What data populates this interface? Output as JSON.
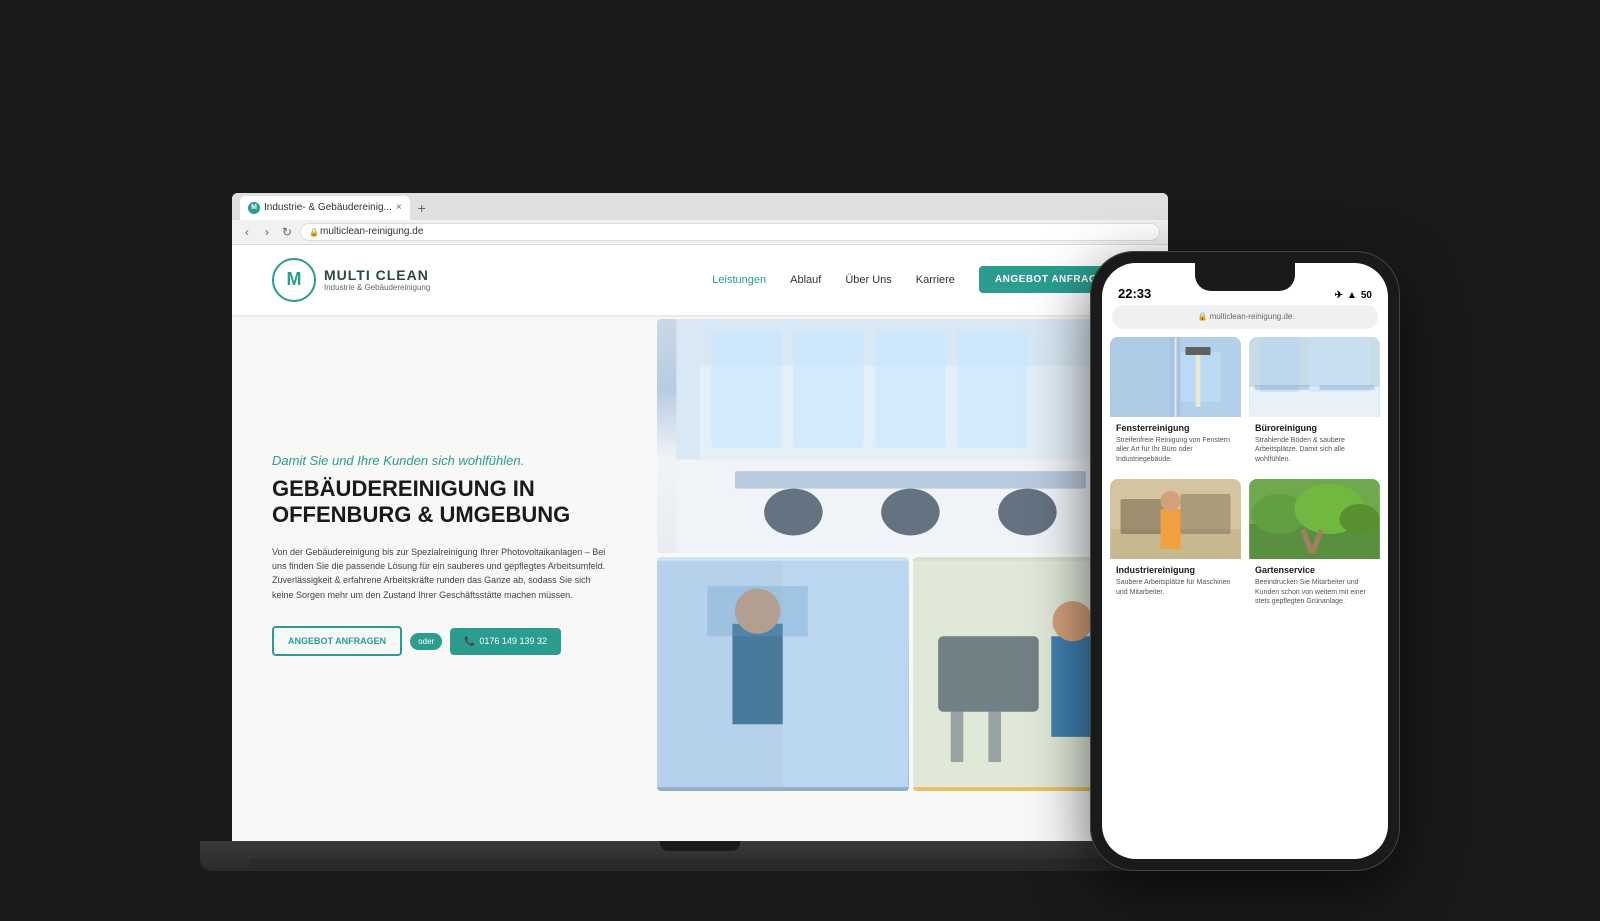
{
  "browser": {
    "tab_title": "Industrie- & Gebäudereinig...",
    "tab_close": "×",
    "tab_add": "+",
    "nav_back": "‹",
    "nav_forward": "›",
    "nav_refresh": "↻",
    "address": "multiclean-reinigung.de",
    "lock_icon": "🔒"
  },
  "site": {
    "logo_letter": "M",
    "logo_main": "MULTI CLEAN",
    "logo_sub": "Industrie & Gebäudereinigung",
    "nav": {
      "items": [
        {
          "label": "Leistungen",
          "active": true
        },
        {
          "label": "Ablauf",
          "active": false
        },
        {
          "label": "Über Uns",
          "active": false
        },
        {
          "label": "Karriere",
          "active": false
        }
      ],
      "cta_btn": "ANGEBOT ANFRAGEN"
    },
    "hero": {
      "tagline": "Damit Sie und Ihre Kunden sich wohlfühlen.",
      "title_line1": "GEBÄUDEREINIGUNG IN",
      "title_line2": "OFFENBURG & UMGEBUNG",
      "description": "Von der Gebäudereinigung bis zur Spezialreinigung Ihrer Photovoltaikanlagen – Bei uns finden Sie die passende Lösung für ein sauberes und gepflegtes Arbeitsumfeld. Zuverlässigkeit & erfahrene Arbeitskräfte runden das Ganze ab, sodass Sie sich keine Sorgen mehr um den Zustand Ihrer Geschäftsstätte machen müssen.",
      "btn_angebot": "ANGEBOT ANFRAGEN",
      "btn_oder": "oder",
      "btn_phone_icon": "📞",
      "btn_phone": "0176 149 139 32"
    }
  },
  "phone": {
    "time": "22:33",
    "icons": "✈ ⊃ 50",
    "address": "multiclean-reinigung.de",
    "services": [
      {
        "title": "Fensterreinigung",
        "description": "Streifenfreie Reinigung von Fenstern aller Art für Ihr Büro oder Industriegebäude.",
        "img_class": "window-clean"
      },
      {
        "title": "Büroreinigung",
        "description": "Strahlende Böden & saubere Arbeitsplätze. Damit sich alle wohlfühlen.",
        "img_class": "office-clean"
      },
      {
        "title": "Industriereinigung",
        "description": "Saubere Arbeitsplätze für Maschinen und Mitarbeiter.",
        "img_class": "industrial"
      },
      {
        "title": "Gartenservice",
        "description": "Beeindrucken Sie Mitarbeiter und Kunden schon von weitem mit einer stets gepflegten Grünanlage.",
        "img_class": "garden"
      }
    ]
  }
}
